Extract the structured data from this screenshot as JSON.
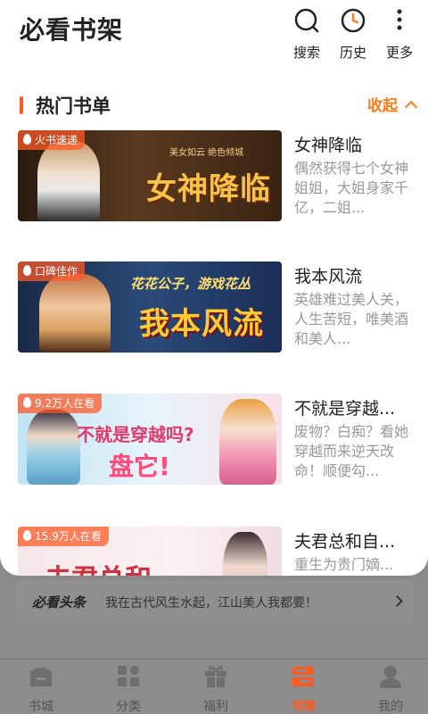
{
  "header": {
    "title": "必看书架",
    "actions": [
      {
        "label": "搜索",
        "icon": "search-icon"
      },
      {
        "label": "历史",
        "icon": "clock-icon"
      },
      {
        "label": "更多",
        "icon": "more-vertical-icon"
      }
    ]
  },
  "section": {
    "title": "热门书单",
    "collapse_label": "收起"
  },
  "books": [
    {
      "badge": "火书速递",
      "cover_text": "女神降临",
      "cover_tag": "美女如云 绝色倾城",
      "title": "女神降临",
      "desc": "偶然获得七个女神姐姐，大姐身家千亿，二姐..."
    },
    {
      "badge": "口碑佳作",
      "cover_text": "我本风流",
      "cover_tag": "花花公子，游戏花丛",
      "title": "我本风流",
      "desc": "英雄难过美人关，人生苦短，唯美酒和美人..."
    },
    {
      "badge": "9.2万人在看",
      "cover_text": "盘它!",
      "cover_tag": "不就是穿越吗?",
      "title": "不就是穿越...",
      "desc": "废物？白痴？看她穿越而来逆天改命！顺便勾..."
    },
    {
      "badge": "15.9万人在看",
      "cover_text": "夫君总和",
      "cover_tag": "",
      "title": "夫君总和自...",
      "desc": "重生为贵门嫡..."
    }
  ],
  "banner": {
    "logo": "必看头条",
    "text": "我在古代风生水起，江山美人我都要！"
  },
  "nav": [
    {
      "label": "书城",
      "icon": "bookstore-icon"
    },
    {
      "label": "分类",
      "icon": "category-icon"
    },
    {
      "label": "福利",
      "icon": "gift-icon"
    },
    {
      "label": "书架",
      "icon": "bookshelf-icon",
      "active": true
    },
    {
      "label": "我的",
      "icon": "profile-icon"
    }
  ],
  "colors": {
    "accent": "#ff5a1e",
    "collapse": "#ff7a1a",
    "desc_gray": "#999999"
  }
}
